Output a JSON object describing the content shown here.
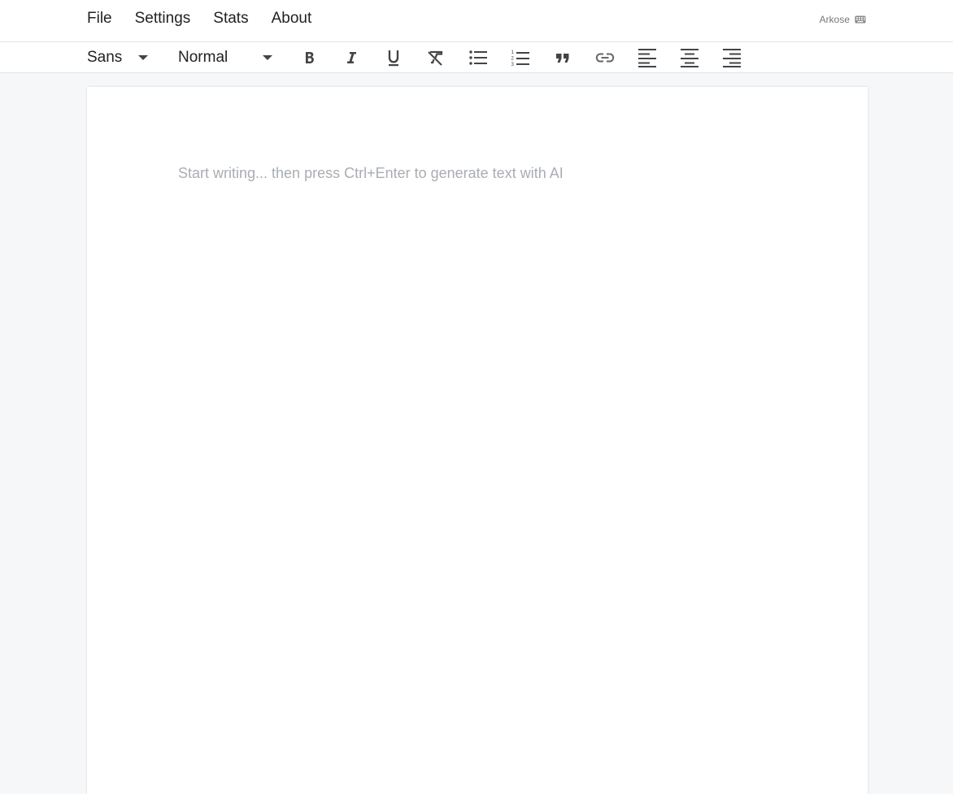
{
  "menubar": {
    "items": [
      {
        "label": "File"
      },
      {
        "label": "Settings"
      },
      {
        "label": "Stats"
      },
      {
        "label": "About"
      }
    ],
    "brand": "Arkose",
    "brand_icon": "keyboard-icon"
  },
  "toolbar": {
    "font_picker": {
      "value": "Sans"
    },
    "size_picker": {
      "value": "Normal"
    },
    "buttons": [
      {
        "icon": "bold-icon"
      },
      {
        "icon": "italic-icon"
      },
      {
        "icon": "underline-icon"
      },
      {
        "icon": "clear-format-icon"
      },
      {
        "icon": "bullet-list-icon"
      },
      {
        "icon": "ordered-list-icon"
      },
      {
        "icon": "blockquote-icon"
      },
      {
        "icon": "link-icon"
      },
      {
        "icon": "align-left-icon"
      },
      {
        "icon": "align-center-icon"
      },
      {
        "icon": "align-right-icon"
      }
    ]
  },
  "editor": {
    "placeholder": "Start writing... then press Ctrl+Enter to generate text with AI"
  },
  "colors": {
    "background": "#f6f7f9",
    "page": "#ffffff",
    "text": "#222222",
    "placeholder": "#a9adb3",
    "icon": "#444444"
  }
}
